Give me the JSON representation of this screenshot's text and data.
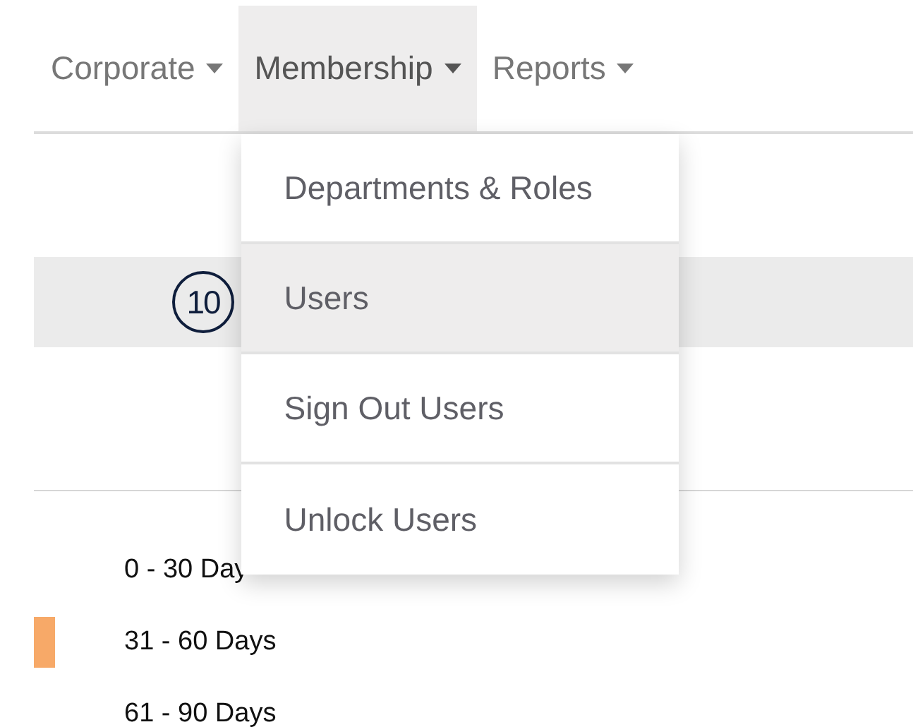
{
  "nav": [
    {
      "label": "Corporate",
      "caret": true,
      "selected": false
    },
    {
      "label": "Membership",
      "caret": true,
      "selected": true
    },
    {
      "label": "Reports",
      "caret": true,
      "selected": false
    }
  ],
  "dropdown": [
    {
      "label": "Departments & Roles",
      "selected": false
    },
    {
      "label": "Users",
      "selected": true
    },
    {
      "label": "Sign Out Users",
      "selected": false
    },
    {
      "label": "Unlock Users",
      "selected": false
    }
  ],
  "step_marker": "10",
  "legend": [
    {
      "label": "0 - 30 Day"
    },
    {
      "label": "31 - 60 Days",
      "color": "#f7a968"
    },
    {
      "label": "61 - 90 Days"
    }
  ]
}
